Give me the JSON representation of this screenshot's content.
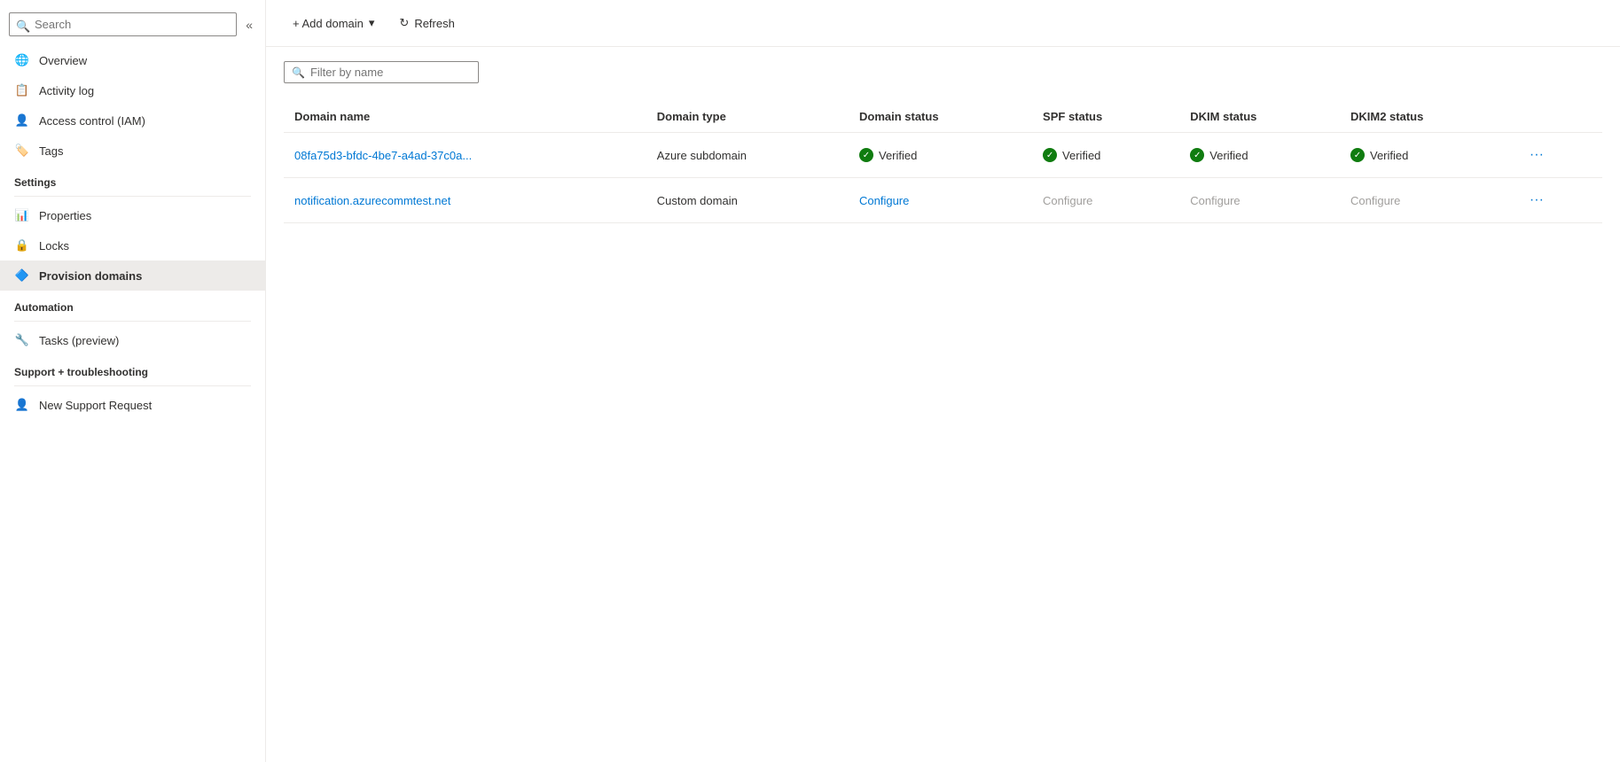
{
  "sidebar": {
    "search": {
      "placeholder": "Search",
      "value": ""
    },
    "collapse_label": "«",
    "nav_items": [
      {
        "id": "overview",
        "label": "Overview",
        "icon": "globe",
        "active": false
      },
      {
        "id": "activity-log",
        "label": "Activity log",
        "icon": "book",
        "active": false
      },
      {
        "id": "access-control",
        "label": "Access control (IAM)",
        "icon": "person",
        "active": false
      },
      {
        "id": "tags",
        "label": "Tags",
        "icon": "tag",
        "active": false
      }
    ],
    "sections": [
      {
        "title": "Settings",
        "items": [
          {
            "id": "properties",
            "label": "Properties",
            "icon": "properties",
            "active": false
          },
          {
            "id": "locks",
            "label": "Locks",
            "icon": "lock",
            "active": false
          },
          {
            "id": "provision-domains",
            "label": "Provision domains",
            "icon": "provision",
            "active": true
          }
        ]
      },
      {
        "title": "Automation",
        "items": [
          {
            "id": "tasks",
            "label": "Tasks (preview)",
            "icon": "tasks",
            "active": false
          }
        ]
      },
      {
        "title": "Support + troubleshooting",
        "items": [
          {
            "id": "new-support",
            "label": "New Support Request",
            "icon": "support",
            "active": false
          }
        ]
      }
    ]
  },
  "toolbar": {
    "add_domain_label": "+ Add domain",
    "add_domain_dropdown": "▾",
    "refresh_label": "Refresh"
  },
  "filter": {
    "placeholder": "Filter by name"
  },
  "table": {
    "columns": [
      "Domain name",
      "Domain type",
      "Domain status",
      "SPF status",
      "DKIM status",
      "DKIM2 status"
    ],
    "rows": [
      {
        "domain_name": "08fa75d3-bfdc-4be7-a4ad-37c0a...",
        "domain_type": "Azure subdomain",
        "domain_status": "Verified",
        "spf_status": "Verified",
        "dkim_status": "Verified",
        "dkim2_status": "Verified",
        "domain_status_type": "verified",
        "spf_type": "verified",
        "dkim_type": "verified",
        "dkim2_type": "verified"
      },
      {
        "domain_name": "notification.azurecommtest.net",
        "domain_type": "Custom domain",
        "domain_status": "Configure",
        "spf_status": "Configure",
        "dkim_status": "Configure",
        "dkim2_status": "Configure",
        "domain_status_type": "configure-blue",
        "spf_type": "configure-gray",
        "dkim_type": "configure-gray",
        "dkim2_type": "configure-gray"
      }
    ]
  }
}
